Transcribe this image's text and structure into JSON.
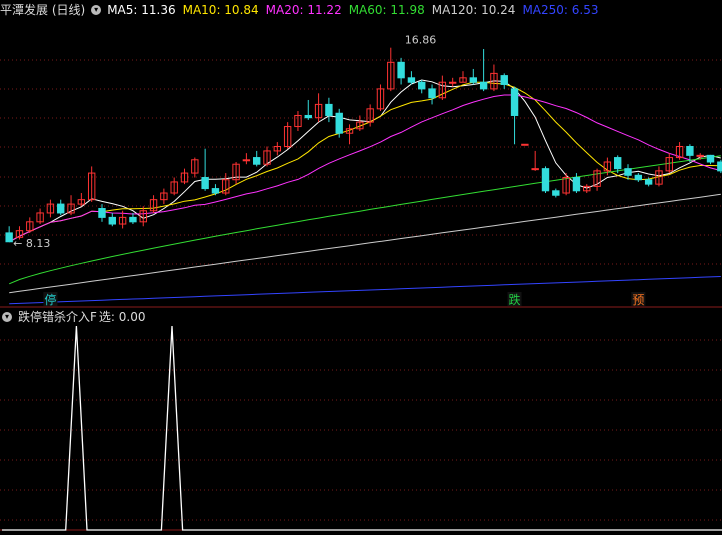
{
  "main_header": {
    "title": "平潭发展 (日线)",
    "indicator_icon": "chevron-down-icon",
    "ma": [
      {
        "label": "MA5: 11.36",
        "color": "#ffffff"
      },
      {
        "label": "MA10: 10.84",
        "color": "#ffe600"
      },
      {
        "label": "MA20: 11.22",
        "color": "#ff33ff"
      },
      {
        "label": "MA60: 11.98",
        "color": "#33dd33"
      },
      {
        "label": "MA120: 10.24",
        "color": "#cccccc"
      },
      {
        "label": "MA250: 6.53",
        "color": "#3344ff"
      }
    ]
  },
  "sub_header": {
    "title": "跌停错杀介入F",
    "value": "选: 0.00"
  },
  "signals": [
    {
      "text": "停",
      "color": "#22cccc",
      "index": 4
    },
    {
      "text": "跌",
      "color": "#22cc44",
      "index": 49
    },
    {
      "text": "预",
      "color": "#ff7722",
      "index": 61
    }
  ],
  "colors": {
    "up": "#ff3333",
    "down": "#33dddd",
    "grid": "#7a1a1a"
  },
  "chart_data": [
    {
      "type": "candlestick",
      "title": "平潭发展 (日线)",
      "ylim": [
        5.2,
        18.2
      ],
      "annotations": [
        {
          "text": "16.86",
          "index": 37,
          "value": 16.86
        },
        {
          "text": "8.13",
          "index": 0,
          "value": 8.13
        }
      ],
      "candles": [
        [
          8.5,
          8.1,
          8.8,
          8.13
        ],
        [
          8.3,
          8.6,
          8.8,
          8.2
        ],
        [
          8.6,
          9.0,
          9.2,
          8.5
        ],
        [
          9.0,
          9.4,
          9.6,
          8.9
        ],
        [
          9.4,
          9.8,
          10.0,
          9.2
        ],
        [
          9.8,
          9.4,
          10.0,
          9.3
        ],
        [
          9.4,
          9.8,
          10.2,
          9.3
        ],
        [
          9.8,
          10.0,
          10.3,
          9.7
        ],
        [
          10.0,
          11.2,
          11.5,
          9.9
        ],
        [
          9.6,
          9.2,
          9.8,
          9.0
        ],
        [
          9.2,
          8.9,
          9.4,
          8.8
        ],
        [
          8.9,
          9.2,
          9.5,
          8.7
        ],
        [
          9.2,
          9.0,
          9.4,
          8.9
        ],
        [
          9.0,
          9.5,
          9.7,
          8.8
        ],
        [
          9.5,
          10.0,
          10.2,
          9.4
        ],
        [
          10.0,
          10.3,
          10.5,
          9.8
        ],
        [
          10.3,
          10.8,
          11.0,
          10.2
        ],
        [
          10.8,
          11.2,
          11.4,
          10.7
        ],
        [
          11.2,
          11.8,
          11.9,
          11.0
        ],
        [
          11.0,
          10.5,
          12.3,
          10.4
        ],
        [
          10.5,
          10.3,
          10.7,
          10.2
        ],
        [
          10.3,
          10.9,
          11.2,
          10.2
        ],
        [
          10.9,
          11.6,
          11.7,
          10.7
        ],
        [
          11.8,
          11.8,
          12.1,
          11.6
        ],
        [
          11.9,
          11.6,
          12.2,
          11.5
        ],
        [
          11.6,
          12.2,
          12.4,
          11.5
        ],
        [
          12.2,
          12.4,
          12.6,
          12.0
        ],
        [
          12.4,
          13.3,
          13.5,
          12.3
        ],
        [
          13.3,
          13.8,
          14.0,
          13.1
        ],
        [
          13.8,
          13.7,
          14.5,
          13.6
        ],
        [
          13.7,
          14.3,
          14.8,
          13.5
        ],
        [
          14.3,
          13.8,
          14.6,
          13.5
        ],
        [
          13.9,
          13.0,
          14.1,
          12.8
        ],
        [
          13.0,
          13.2,
          13.4,
          12.5
        ],
        [
          13.2,
          13.5,
          13.8,
          13.1
        ],
        [
          13.5,
          14.1,
          14.3,
          13.3
        ],
        [
          14.1,
          15.0,
          15.2,
          14.0
        ],
        [
          15.0,
          16.2,
          16.86,
          14.9
        ],
        [
          16.2,
          15.5,
          16.4,
          15.2
        ],
        [
          15.5,
          15.3,
          15.8,
          15.2
        ],
        [
          15.3,
          15.0,
          15.4,
          14.8
        ],
        [
          15.0,
          14.6,
          15.2,
          14.3
        ],
        [
          14.6,
          15.3,
          15.6,
          14.5
        ],
        [
          15.3,
          15.3,
          15.5,
          15.1
        ],
        [
          15.3,
          15.5,
          15.8,
          15.3
        ],
        [
          15.5,
          15.3,
          15.9,
          15.2
        ],
        [
          15.3,
          15.0,
          16.8,
          14.9
        ],
        [
          15.0,
          15.7,
          16.1,
          14.9
        ],
        [
          15.6,
          15.2,
          15.7,
          15.0
        ],
        [
          15.0,
          13.8,
          15.1,
          12.5
        ],
        [
          12.5,
          12.5,
          12.5,
          12.5
        ],
        [
          11.4,
          11.4,
          12.2,
          11.3
        ],
        [
          11.4,
          10.4,
          11.5,
          10.3
        ],
        [
          10.4,
          10.2,
          10.5,
          10.1
        ],
        [
          10.3,
          11.0,
          11.2,
          10.2
        ],
        [
          11.0,
          10.4,
          11.2,
          10.3
        ],
        [
          10.4,
          10.6,
          10.7,
          10.3
        ],
        [
          10.6,
          11.3,
          11.4,
          10.4
        ],
        [
          11.3,
          11.7,
          11.9,
          11.1
        ],
        [
          11.9,
          11.4,
          12.0,
          11.2
        ],
        [
          11.4,
          11.1,
          11.6,
          10.9
        ],
        [
          11.1,
          10.9,
          11.2,
          10.8
        ],
        [
          10.9,
          10.7,
          11.0,
          10.6
        ],
        [
          10.7,
          11.3,
          11.5,
          10.6
        ],
        [
          11.3,
          11.9,
          12.1,
          11.2
        ],
        [
          11.9,
          12.4,
          12.6,
          11.8
        ],
        [
          12.4,
          12.0,
          12.5,
          11.7
        ],
        [
          12.0,
          12.0,
          12.1,
          11.8
        ],
        [
          12.0,
          11.7,
          12.0,
          11.6
        ],
        [
          11.7,
          11.3,
          11.8,
          11.2
        ]
      ],
      "ma_values": {
        "MA5": 11.36,
        "MA10": 10.84,
        "MA20": 11.22,
        "MA60": 11.98,
        "MA120": 10.24,
        "MA250": 6.53
      }
    },
    {
      "type": "line",
      "title": "跌停错杀介入F",
      "series": [
        {
          "name": "选",
          "values": [
            0,
            0,
            0,
            0,
            0,
            0,
            0,
            1,
            0,
            0,
            0,
            0,
            0,
            0,
            0,
            0,
            1,
            0,
            0,
            0,
            0,
            0,
            0,
            0,
            0,
            0,
            0,
            0,
            0,
            0,
            0,
            0,
            0,
            0,
            0,
            0,
            0,
            0,
            0,
            0,
            0,
            0,
            0,
            0,
            0,
            0,
            0,
            0,
            0,
            0,
            0,
            0,
            0,
            0,
            0,
            0,
            0,
            0,
            0,
            0,
            0,
            0,
            0,
            0,
            0,
            0,
            0,
            0,
            0,
            0
          ]
        }
      ],
      "ylim": [
        0,
        1
      ]
    }
  ]
}
